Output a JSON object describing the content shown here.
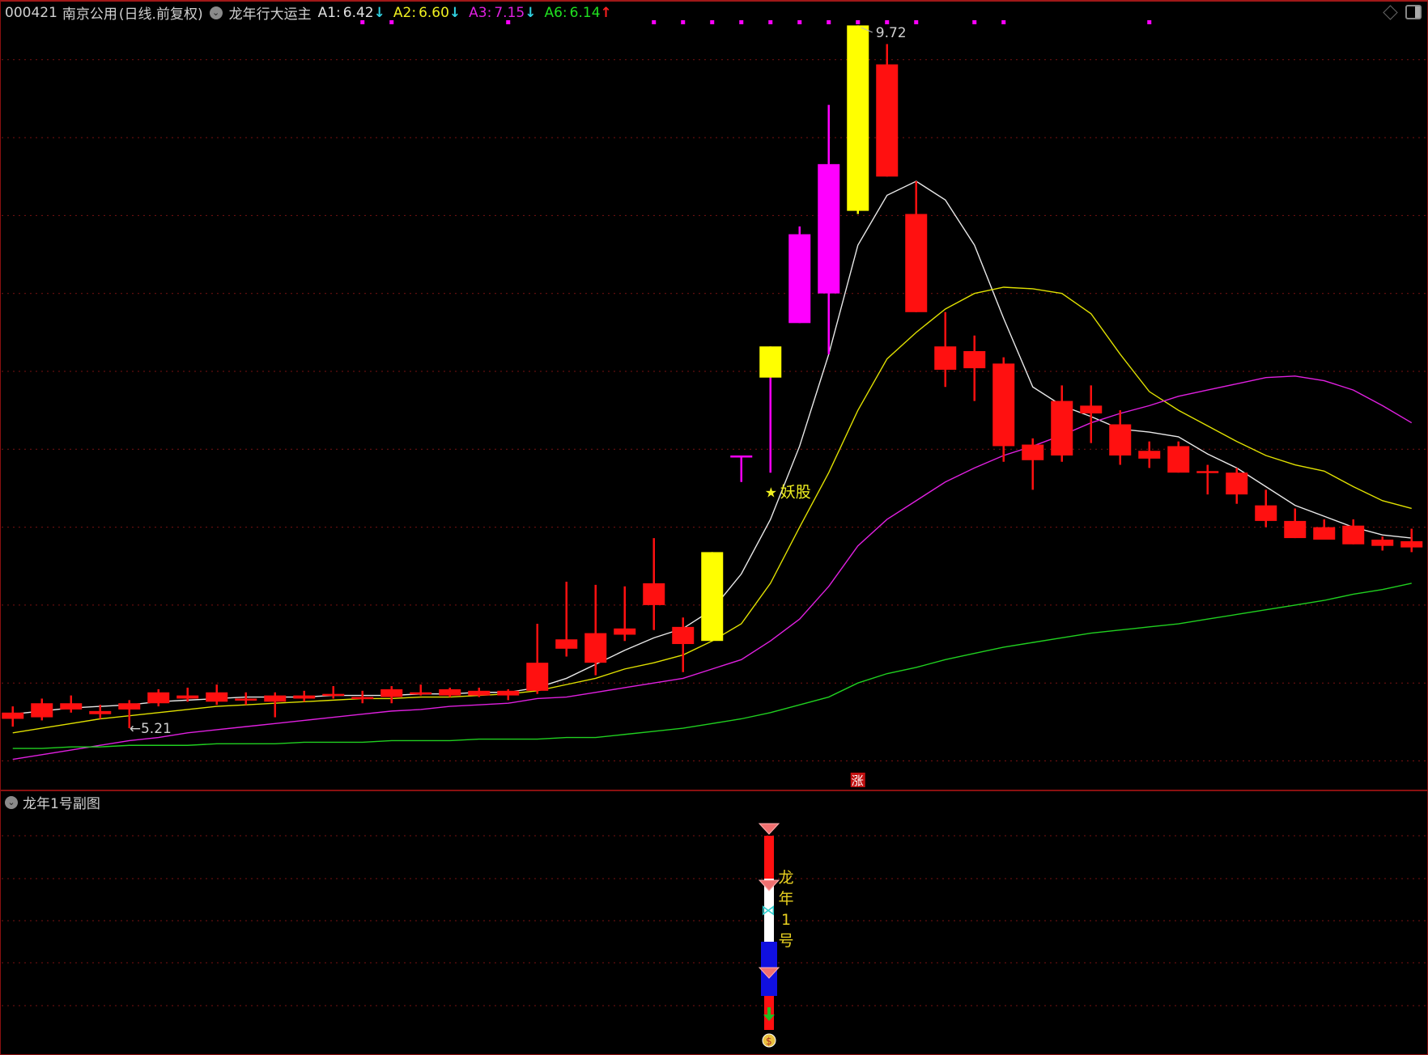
{
  "header": {
    "code": "000421",
    "name": "南京公用",
    "period": "(日线.前复权)",
    "indicator": "龙年行大运主",
    "values": [
      {
        "label": "A1:",
        "value": "6.42",
        "arrow": "↓",
        "color": "#e0e0e0",
        "arrow_color": "#30d0e0"
      },
      {
        "label": "A2:",
        "value": "6.60",
        "arrow": "↓",
        "color": "#f0f020",
        "arrow_color": "#30d0e0"
      },
      {
        "label": "A3:",
        "value": "7.15",
        "arrow": "↓",
        "color": "#e020e0",
        "arrow_color": "#30d0e0"
      },
      {
        "label": "A6:",
        "value": "6.14",
        "arrow": "↑",
        "color": "#20e020",
        "arrow_color": "#ff2020"
      }
    ]
  },
  "window_icons": [
    "diamond-icon",
    "panel-toggle-icon"
  ],
  "subchart": {
    "title": "龙年1号副图",
    "label_chars": [
      "龙",
      "年",
      "1",
      "号"
    ]
  },
  "chart_data": {
    "type": "candlestick",
    "ylim": [
      5.0,
      9.75
    ],
    "grid_prices": [
      5.0,
      5.5,
      6.0,
      6.5,
      7.0,
      7.5,
      8.0,
      8.5,
      9.0,
      9.5
    ],
    "annotations": {
      "high": {
        "index": 29,
        "text": "9.72"
      },
      "low": {
        "index": 4,
        "text": "5.21"
      },
      "star": {
        "index": 26,
        "price": 6.73,
        "text": "妖股"
      },
      "zhang": {
        "index": 29,
        "text": "涨"
      }
    },
    "signal_dots": [
      12,
      13,
      17,
      22,
      23,
      24,
      25,
      26,
      27,
      28,
      29,
      30,
      31,
      33,
      34,
      39
    ],
    "colors": {
      "up": "#ff1010",
      "yellow": "#ffff00",
      "magenta": "#ff00ff",
      "ma5": "#e8e8e8",
      "ma10": "#e0e000",
      "ma20": "#e020e0",
      "ma60": "#20d020"
    },
    "candles": [
      [
        5.27,
        5.31,
        5.35,
        5.22,
        "red"
      ],
      [
        5.28,
        5.37,
        5.4,
        5.26,
        "red"
      ],
      [
        5.33,
        5.37,
        5.42,
        5.31,
        "red"
      ],
      [
        5.3,
        5.32,
        5.36,
        5.27,
        "red"
      ],
      [
        5.33,
        5.37,
        5.39,
        5.21,
        "red"
      ],
      [
        5.37,
        5.44,
        5.46,
        5.35,
        "red"
      ],
      [
        5.4,
        5.42,
        5.47,
        5.38,
        "red"
      ],
      [
        5.38,
        5.44,
        5.49,
        5.36,
        "red"
      ],
      [
        5.39,
        5.4,
        5.44,
        5.36,
        "red"
      ],
      [
        5.38,
        5.42,
        5.44,
        5.28,
        "red"
      ],
      [
        5.4,
        5.42,
        5.45,
        5.38,
        "red"
      ],
      [
        5.42,
        5.43,
        5.48,
        5.4,
        "red"
      ],
      [
        5.4,
        5.41,
        5.45,
        5.37,
        "red"
      ],
      [
        5.41,
        5.46,
        5.48,
        5.37,
        "red"
      ],
      [
        5.43,
        5.44,
        5.49,
        5.42,
        "red"
      ],
      [
        5.42,
        5.46,
        5.47,
        5.41,
        "red"
      ],
      [
        5.42,
        5.45,
        5.47,
        5.41,
        "red"
      ],
      [
        5.42,
        5.45,
        5.46,
        5.39,
        "red"
      ],
      [
        5.45,
        5.63,
        5.88,
        5.43,
        "red"
      ],
      [
        5.72,
        5.78,
        6.15,
        5.67,
        "red"
      ],
      [
        5.63,
        5.82,
        6.13,
        5.55,
        "red"
      ],
      [
        5.81,
        5.85,
        6.12,
        5.77,
        "red"
      ],
      [
        6.0,
        6.14,
        6.43,
        5.84,
        "red"
      ],
      [
        5.75,
        5.86,
        5.92,
        5.57,
        "red"
      ],
      [
        5.77,
        6.34,
        6.34,
        5.77,
        "yellow"
      ],
      [
        6.95,
        6.96,
        6.96,
        6.79,
        "magenta"
      ],
      [
        7.46,
        7.66,
        7.66,
        6.85,
        "yellow"
      ],
      [
        7.81,
        8.38,
        8.43,
        7.81,
        "magenta"
      ],
      [
        8.0,
        8.83,
        9.21,
        7.61,
        "magenta"
      ],
      [
        8.53,
        9.72,
        9.72,
        8.51,
        "yellow"
      ],
      [
        9.47,
        8.75,
        9.6,
        8.75,
        "red"
      ],
      [
        8.51,
        7.88,
        8.72,
        7.88,
        "red"
      ],
      [
        7.66,
        7.51,
        7.88,
        7.4,
        "red"
      ],
      [
        7.63,
        7.52,
        7.73,
        7.31,
        "red"
      ],
      [
        7.55,
        7.02,
        7.59,
        6.92,
        "red"
      ],
      [
        7.03,
        6.93,
        7.07,
        6.74,
        "red"
      ],
      [
        7.31,
        6.96,
        7.41,
        6.92,
        "red"
      ],
      [
        7.28,
        7.23,
        7.41,
        7.04,
        "red"
      ],
      [
        7.16,
        6.96,
        7.25,
        6.9,
        "red"
      ],
      [
        6.99,
        6.94,
        7.05,
        6.88,
        "red"
      ],
      [
        7.02,
        6.85,
        7.05,
        6.85,
        "red"
      ],
      [
        6.86,
        6.85,
        6.9,
        6.71,
        "red"
      ],
      [
        6.85,
        6.71,
        6.88,
        6.65,
        "red"
      ],
      [
        6.64,
        6.54,
        6.74,
        6.5,
        "red"
      ],
      [
        6.54,
        6.43,
        6.62,
        6.43,
        "red"
      ],
      [
        6.5,
        6.42,
        6.55,
        6.42,
        "red"
      ],
      [
        6.51,
        6.39,
        6.55,
        6.39,
        "red"
      ],
      [
        6.42,
        6.38,
        6.44,
        6.35,
        "red"
      ],
      [
        6.41,
        6.37,
        6.49,
        6.34,
        "red"
      ]
    ],
    "series": [
      {
        "key": "ma5",
        "values": [
          5.3,
          5.32,
          5.34,
          5.35,
          5.36,
          5.38,
          5.39,
          5.4,
          5.41,
          5.41,
          5.41,
          5.42,
          5.42,
          5.42,
          5.43,
          5.43,
          5.44,
          5.44,
          5.47,
          5.53,
          5.62,
          5.71,
          5.79,
          5.85,
          5.97,
          6.2,
          6.55,
          7.02,
          7.61,
          8.31,
          8.63,
          8.72,
          8.6,
          8.31,
          7.84,
          7.4,
          7.28,
          7.21,
          7.13,
          7.11,
          7.08,
          6.97,
          6.88,
          6.76,
          6.64,
          6.57,
          6.5,
          6.45,
          6.43
        ]
      },
      {
        "key": "ma10",
        "values": [
          5.18,
          5.21,
          5.24,
          5.27,
          5.29,
          5.31,
          5.33,
          5.35,
          5.36,
          5.37,
          5.38,
          5.39,
          5.4,
          5.4,
          5.41,
          5.41,
          5.42,
          5.43,
          5.45,
          5.49,
          5.53,
          5.59,
          5.63,
          5.68,
          5.77,
          5.88,
          6.14,
          6.5,
          6.85,
          7.25,
          7.58,
          7.75,
          7.9,
          8.0,
          8.04,
          8.03,
          8.0,
          7.87,
          7.61,
          7.37,
          7.25,
          7.15,
          7.05,
          6.96,
          6.9,
          6.86,
          6.76,
          6.67,
          6.62
        ]
      },
      {
        "key": "ma20",
        "values": [
          5.01,
          5.04,
          5.07,
          5.1,
          5.13,
          5.15,
          5.18,
          5.2,
          5.22,
          5.24,
          5.26,
          5.28,
          5.3,
          5.32,
          5.33,
          5.35,
          5.36,
          5.37,
          5.4,
          5.41,
          5.44,
          5.47,
          5.5,
          5.53,
          5.59,
          5.65,
          5.77,
          5.91,
          6.12,
          6.38,
          6.55,
          6.67,
          6.79,
          6.88,
          6.96,
          7.02,
          7.09,
          7.17,
          7.23,
          7.28,
          7.34,
          7.38,
          7.42,
          7.46,
          7.47,
          7.44,
          7.38,
          7.28,
          7.17
        ]
      },
      {
        "key": "ma60",
        "values": [
          5.08,
          5.08,
          5.09,
          5.09,
          5.1,
          5.1,
          5.1,
          5.11,
          5.11,
          5.11,
          5.12,
          5.12,
          5.12,
          5.13,
          5.13,
          5.13,
          5.14,
          5.14,
          5.14,
          5.15,
          5.15,
          5.17,
          5.19,
          5.21,
          5.24,
          5.27,
          5.31,
          5.36,
          5.41,
          5.5,
          5.56,
          5.6,
          5.65,
          5.69,
          5.73,
          5.76,
          5.79,
          5.82,
          5.84,
          5.86,
          5.88,
          5.91,
          5.94,
          5.97,
          6.0,
          6.03,
          6.07,
          6.1,
          6.14
        ]
      }
    ]
  }
}
